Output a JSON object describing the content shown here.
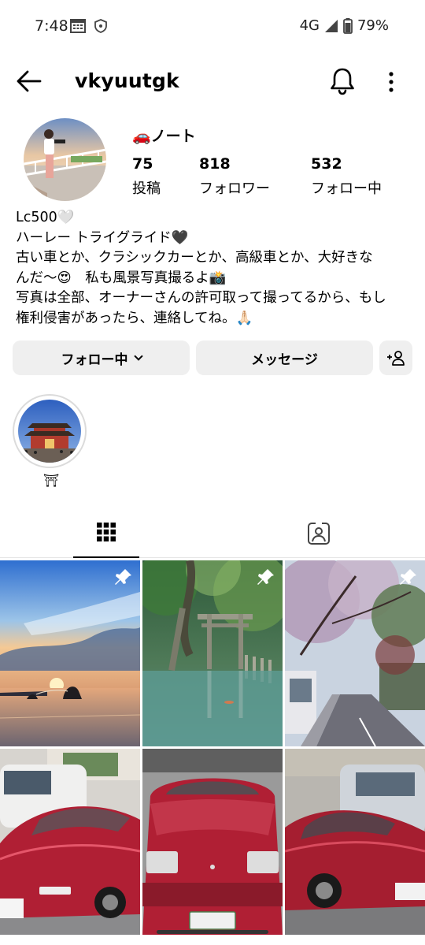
{
  "status_bar": {
    "time": "7:48",
    "network": "4G",
    "battery": "79%"
  },
  "header": {
    "username": "vkyuutgk"
  },
  "profile": {
    "name": "🚗ノート",
    "stats": [
      {
        "value": "75",
        "label": "投稿"
      },
      {
        "value": "818",
        "label": "フォロワー"
      },
      {
        "value": "532",
        "label": "フォロー中"
      }
    ],
    "bio_lines": [
      "Lc500🤍",
      "ハーレー トライグライド🖤",
      "古い車とか、クラシックカーとか、高級車とか、大好きな",
      "んだ〜😍　私も風景写真撮るよ📸",
      "写真は全部、オーナーさんの許可取って撮ってるから、もし",
      "権利侵害があったら、連絡してね。🙏🏻"
    ]
  },
  "actions": {
    "follow_label": "フォロー中",
    "message_label": "メッセージ"
  },
  "highlights": [
    {
      "label": "⛩"
    }
  ],
  "tabs": [
    {
      "icon": "grid-icon",
      "active": true
    },
    {
      "icon": "tagged-icon",
      "active": false
    }
  ],
  "posts": [
    {
      "subject": "seaside sunset",
      "pinned": true
    },
    {
      "subject": "torii in water",
      "pinned": true
    },
    {
      "subject": "cherry blossom street",
      "pinned": true
    },
    {
      "subject": "red sports car",
      "pinned": false
    },
    {
      "subject": "red sports car",
      "pinned": false
    },
    {
      "subject": "red sports car",
      "pinned": false
    }
  ],
  "colors": {
    "button_bg": "#efefef",
    "text": "#000000",
    "car_red": "#b01f34"
  }
}
